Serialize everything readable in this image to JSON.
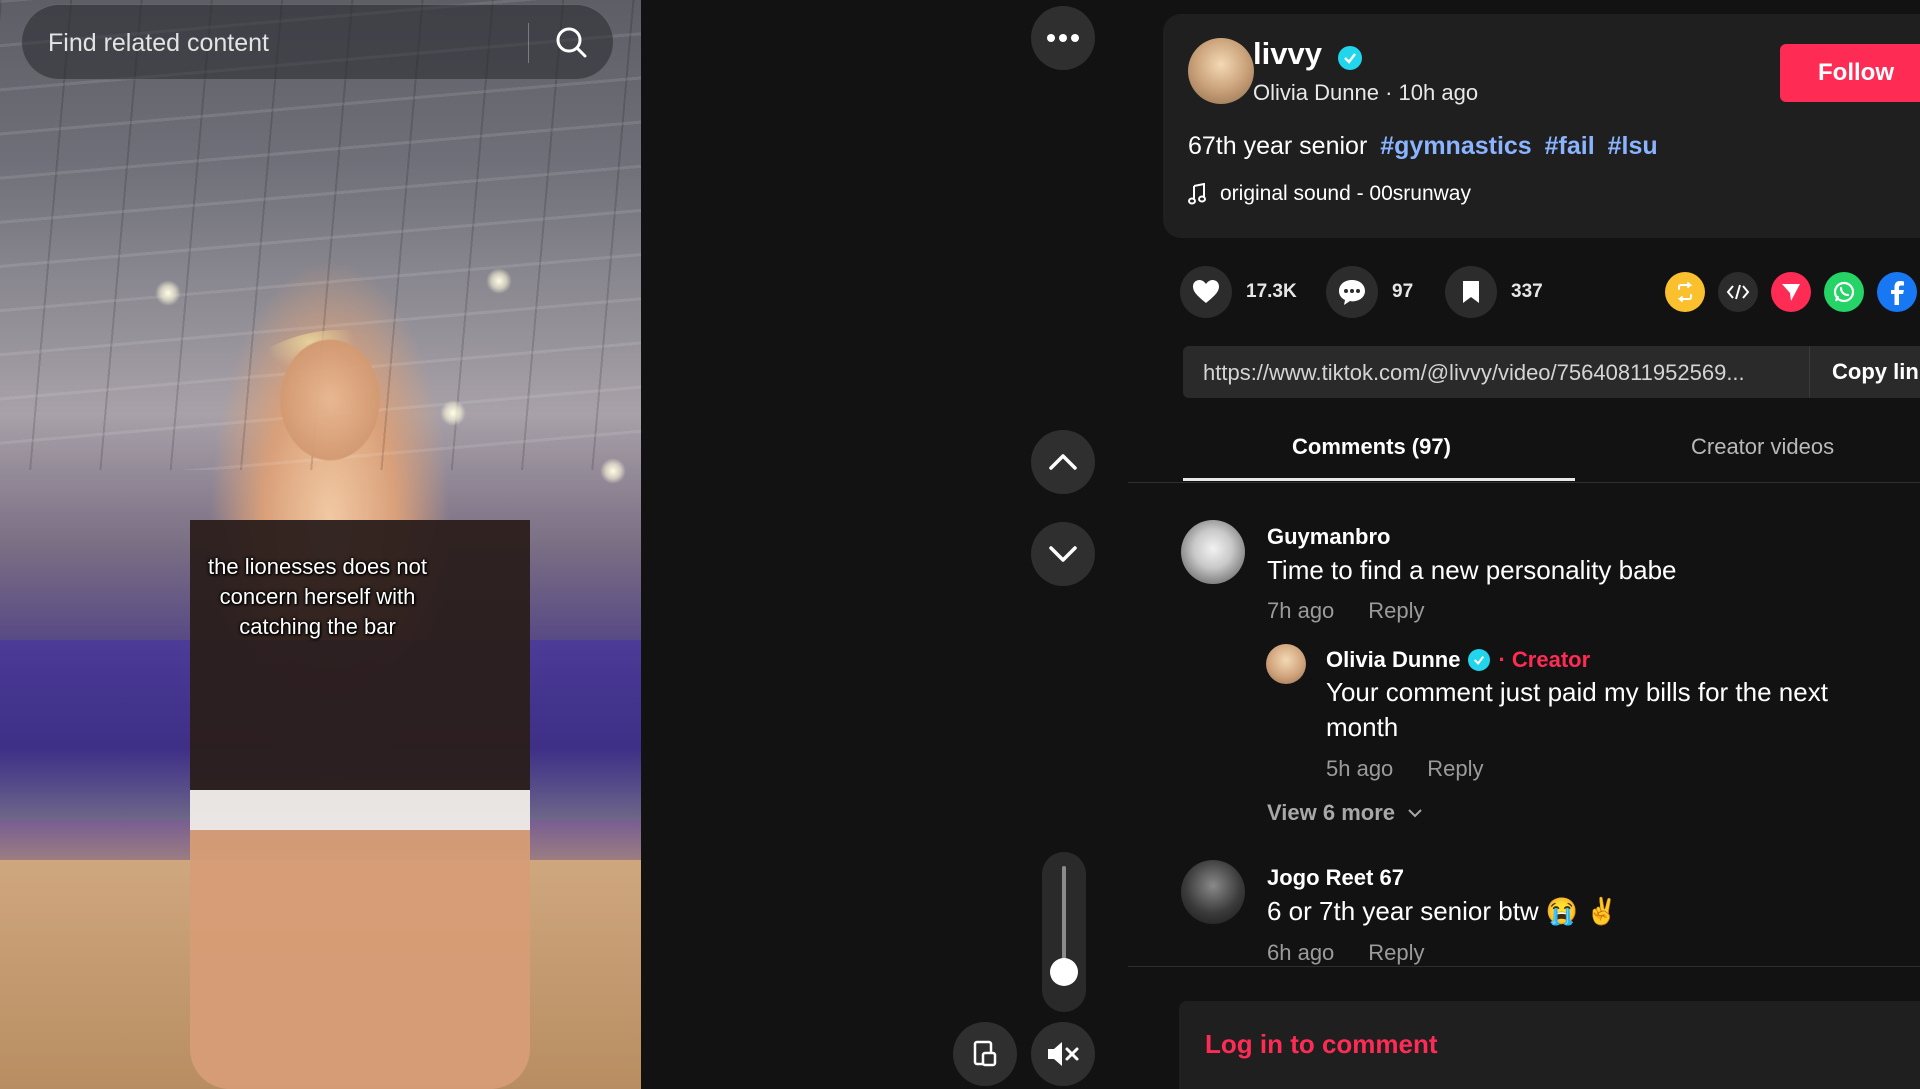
{
  "search": {
    "placeholder": "Find related content"
  },
  "video": {
    "caption": "the lionesses does not concern herself with catching the bar"
  },
  "controls": {
    "more_icon": "ellipsis-icon",
    "volume_level": 0.1
  },
  "post": {
    "username": "livvy",
    "display_name": "Olivia Dunne",
    "time": "10h ago",
    "follow_label": "Follow",
    "description": "67th year senior",
    "hashtags": [
      "#gymnastics",
      "#fail",
      "#lsu"
    ],
    "sound": "original sound - 00srunway"
  },
  "stats": {
    "likes": "17.3K",
    "comments": "97",
    "saves": "337"
  },
  "share": {
    "url": "https://www.tiktok.com/@livvy/video/75640811952569...",
    "copy_label": "Copy link"
  },
  "tabs": {
    "comments": "Comments (97)",
    "creator_videos": "Creator videos"
  },
  "comments": [
    {
      "name": "Guymanbro",
      "text": "Time to find a new personality babe",
      "time": "7h ago",
      "reply": "Reply",
      "replies": [
        {
          "name": "Olivia Dunne",
          "badge": "· Creator",
          "text": "Your comment just paid my bills for the next month",
          "time": "5h ago",
          "reply": "Reply"
        }
      ],
      "view_more": "View 6 more"
    },
    {
      "name": "Jogo Reet 67",
      "text": "6 or 7th year senior btw 😭 ✌️",
      "time": "6h ago",
      "reply": "Reply"
    }
  ],
  "login": {
    "label": "Log in to comment"
  },
  "colors": {
    "accent": "#fe2c55",
    "verified": "#20d5ec",
    "hashtag": "#8ab4ff"
  }
}
